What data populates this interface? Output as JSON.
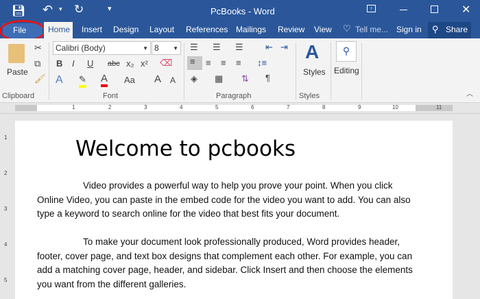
{
  "window": {
    "title": "PcBooks - Word"
  },
  "qat": {
    "save": "save-icon",
    "undo": "undo-icon",
    "redo": "redo-icon",
    "customize": "▾"
  },
  "tabs": [
    "File",
    "Home",
    "Insert",
    "Design",
    "Layout",
    "References",
    "Mailings",
    "Review",
    "View"
  ],
  "tell_me": "Tell me...",
  "sign_in": "Sign in",
  "share": "Share",
  "ribbon": {
    "clipboard": {
      "label": "Clipboard",
      "paste": "Paste"
    },
    "font": {
      "label": "Font",
      "font_name": "Calibri (Body)",
      "font_size": "8",
      "bold": "B",
      "italic": "I",
      "underline": "U",
      "strike": "abc",
      "sub": "x₂",
      "sup": "x²",
      "case": "Aa",
      "grow": "A",
      "shrink": "A"
    },
    "paragraph": {
      "label": "Paragraph",
      "pilcrow": "¶"
    },
    "styles": {
      "label": "Styles",
      "button": "Styles"
    },
    "editing": {
      "button": "Editing"
    }
  },
  "ruler": [
    "1",
    "2",
    "3",
    "4",
    "5",
    "6",
    "7",
    "8",
    "9",
    "10",
    "11"
  ],
  "vruler": [
    "1",
    "2",
    "3",
    "4",
    "5"
  ],
  "document": {
    "heading": "Welcome to pcbooks",
    "paragraphs": [
      "Video provides a powerful way to help you prove your point. When you click Online Video, you can paste in the embed code for the video you want to add. You can also type a keyword to search online for the video that best fits your document.",
      "To make your document look professionally produced, Word provides header, footer, cover page, and text box designs that complement each other. For example, you can add a matching cover page, header, and sidebar. Click Insert and then choose the elements you want from the different galleries."
    ]
  },
  "colors": {
    "accent": "#2b579a",
    "highlight_ring": "#e0161b"
  }
}
